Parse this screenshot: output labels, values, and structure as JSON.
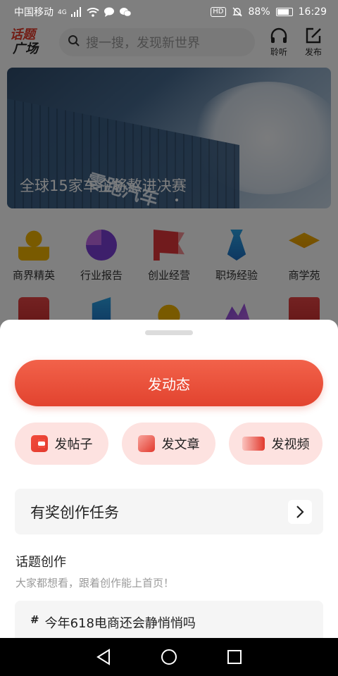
{
  "status_bar": {
    "carrier": "中国移动",
    "network": "4G",
    "hd": "HD",
    "battery": "88%",
    "time": "16:29"
  },
  "header": {
    "logo_line1": "话题",
    "logo_line2": "广场",
    "search_placeholder": "搜一搜，发现新世界",
    "listen_label": "聆听",
    "publish_label": "发布"
  },
  "banner": {
    "brand": "零跑汽车",
    "caption": "全球15家车企将熬进决赛"
  },
  "categories": [
    {
      "label": "商界精英",
      "icon": "businessman-icon"
    },
    {
      "label": "行业报告",
      "icon": "pie-chart-icon"
    },
    {
      "label": "创业经营",
      "icon": "flag-icon"
    },
    {
      "label": "职场经验",
      "icon": "tie-icon"
    },
    {
      "label": "商学苑",
      "icon": "graduation-cap-icon"
    }
  ],
  "sheet": {
    "primary_button": "发动态",
    "options": [
      {
        "label": "发帖子",
        "icon": "post-icon"
      },
      {
        "label": "发文章",
        "icon": "article-icon"
      },
      {
        "label": "发视频",
        "icon": "video-icon"
      }
    ],
    "task_label": "有奖创作任务",
    "section_title": "话题创作",
    "section_subtitle": "大家都想看，跟着创作能上首页！",
    "topic_hash": "#",
    "topic_text": "今年618电商还会静悄悄吗"
  },
  "colors": {
    "accent": "#e2432f",
    "pill_bg": "#fde2e0",
    "row_bg": "#f5f5f5"
  }
}
